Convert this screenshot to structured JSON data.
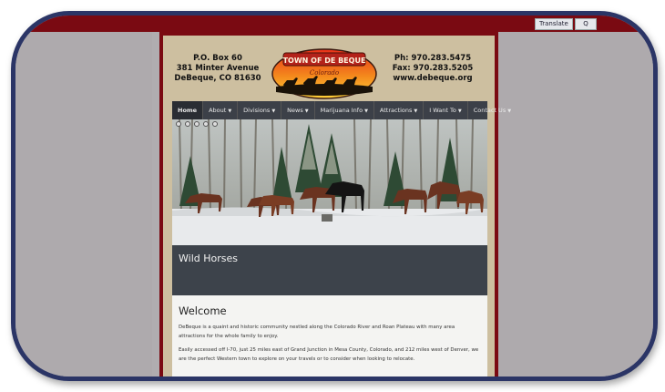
{
  "topbar": {
    "translate_label": "Translate",
    "search_label": "Q"
  },
  "header": {
    "address": [
      "P.O. Box 60",
      "381 Minter Avenue",
      "DeBeque, CO 81630"
    ],
    "contact": [
      "Ph: 970.283.5475",
      "Fax: 970.283.5205",
      "www.debeque.org"
    ],
    "logo": {
      "title": "TOWN OF DE BEQUE",
      "subtitle": "Colorado"
    }
  },
  "nav": {
    "items": [
      {
        "label": "Home",
        "dropdown": false
      },
      {
        "label": "About",
        "dropdown": true
      },
      {
        "label": "Divisions",
        "dropdown": true
      },
      {
        "label": "News",
        "dropdown": true
      },
      {
        "label": "Marijuana Info",
        "dropdown": true
      },
      {
        "label": "Attractions",
        "dropdown": true
      },
      {
        "label": "I Want To",
        "dropdown": true
      },
      {
        "label": "Contact Us",
        "dropdown": true
      }
    ]
  },
  "hero": {
    "caption": "Wild Horses",
    "slide_count": 5
  },
  "main": {
    "heading": "Welcome",
    "paragraphs": [
      "DeBeque is a quaint and historic community nestled along the Colorado River and Roan Plateau with many area attractions for the whole family to enjoy.",
      "Easily accessed off I-70, just 25 miles east of Grand Junction in Mesa County, Colorado, and 212 miles west of Denver, we are the perfect Western town to explore on your travels or to consider when looking to relocate."
    ]
  },
  "colors": {
    "maroon": "#7a0a12",
    "tan": "#cdbfa0",
    "nav": "#3c4048",
    "frame": "#2b3566"
  }
}
